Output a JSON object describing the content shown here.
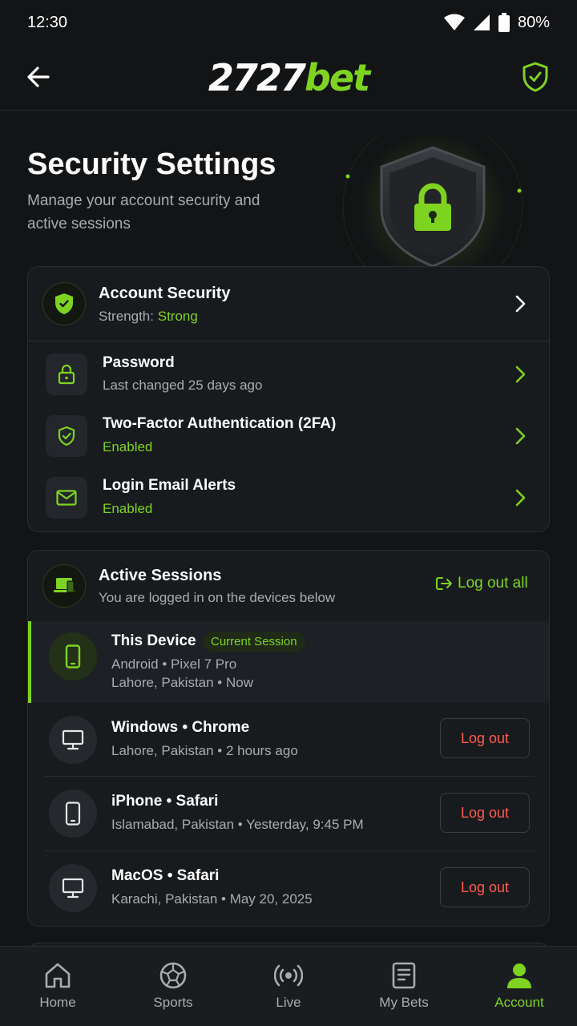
{
  "status_bar": {
    "time": "12:30",
    "battery": "80%"
  },
  "header": {
    "logo_number": "2727",
    "logo_word": "bet"
  },
  "hero": {
    "title": "Security Settings",
    "subtitle": "Manage your account security and active sessions"
  },
  "account_security": {
    "title": "Account Security",
    "strength_label": "Strength:",
    "strength_value": "Strong",
    "items": [
      {
        "title": "Password",
        "subtitle": "Last changed 25 days ago",
        "icon": "lock-icon"
      },
      {
        "title": "Two-Factor Authentication (2FA)",
        "subtitle": "Enabled",
        "icon": "shield-check-icon"
      },
      {
        "title": "Login Email Alerts",
        "subtitle": "Enabled",
        "icon": "mail-icon"
      }
    ]
  },
  "sessions": {
    "title": "Active Sessions",
    "subtitle": "You are logged in on the devices below",
    "logout_all": "Log out all",
    "current": {
      "name": "This Device",
      "badge": "Current Session",
      "detail1": "Android • Pixel 7 Pro",
      "detail2": "Lahore, Pakistan • Now"
    },
    "list": [
      {
        "name": "Windows • Chrome",
        "detail": "Lahore, Pakistan • 2 hours ago",
        "button": "Log out",
        "icon": "monitor-icon"
      },
      {
        "name": "iPhone • Safari",
        "detail": "Islamabad, Pakistan • Yesterday, 9:45 PM",
        "button": "Log out",
        "icon": "phone-icon"
      },
      {
        "name": "MacOS • Safari",
        "detail": "Karachi, Pakistan • May 20, 2025",
        "button": "Log out",
        "icon": "monitor-icon"
      }
    ]
  },
  "nav": [
    {
      "label": "Home",
      "icon": "home-icon"
    },
    {
      "label": "Sports",
      "icon": "ball-icon"
    },
    {
      "label": "Live",
      "icon": "broadcast-icon"
    },
    {
      "label": "My Bets",
      "icon": "receipt-icon"
    },
    {
      "label": "Account",
      "icon": "user-icon",
      "active": true
    }
  ],
  "colors": {
    "accent": "#7ed321",
    "danger": "#ff5a4e",
    "background": "#121416",
    "card": "#181b1e"
  }
}
